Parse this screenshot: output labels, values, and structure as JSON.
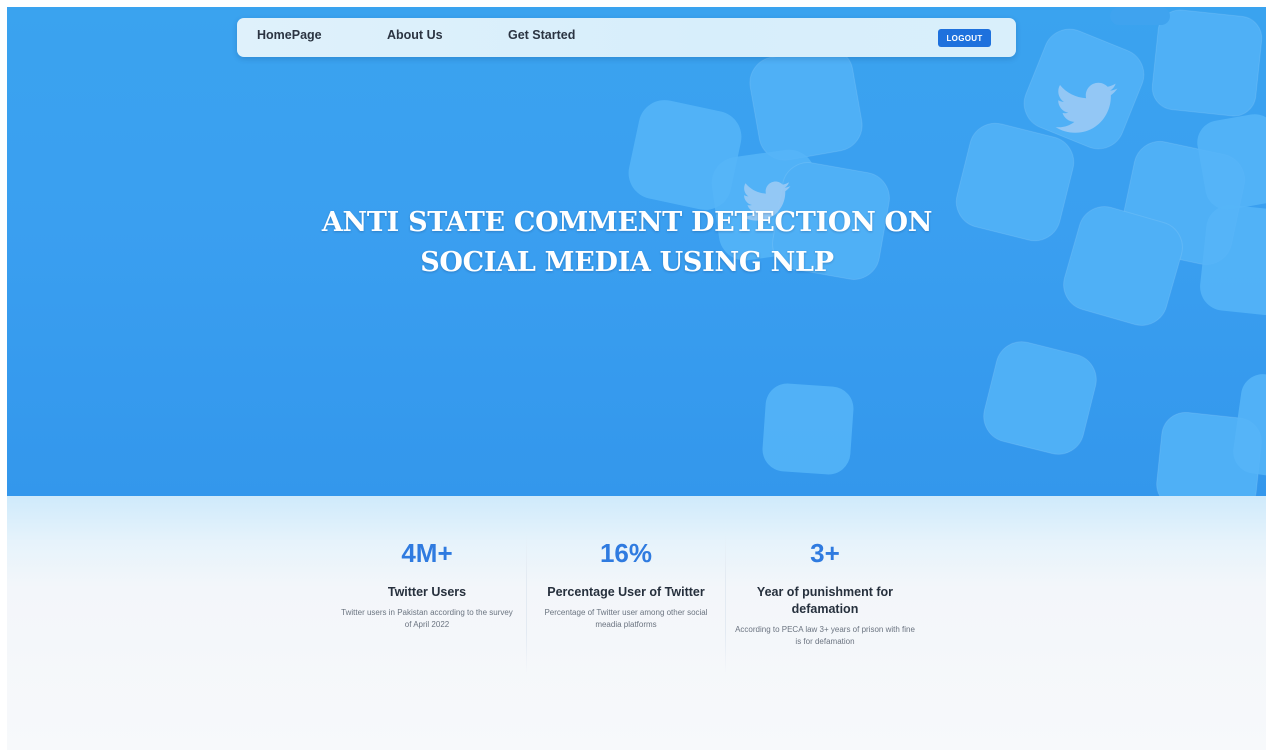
{
  "nav": {
    "home": "HomePage",
    "about": "About Us",
    "get_started": "Get Started",
    "logout": "LOGOUT"
  },
  "hero": {
    "title": "ANTI STATE COMMENT DETECTION ON SOCIAL MEDIA USING NLP"
  },
  "stats": [
    {
      "number": "4M+",
      "title": "Twitter Users",
      "description": "Twitter users in Pakistan according to the survey of April 2022"
    },
    {
      "number": "16%",
      "title": "Percentage User of Twitter",
      "description": "Percentage of Twitter user among other social meadia platforms"
    },
    {
      "number": "3+",
      "title": "Year of punishment for defamation",
      "description": "According to PECA law 3+ years of prison with fine is for defamation"
    }
  ],
  "colors": {
    "hero_blue": "#3a9ff0",
    "accent_blue": "#2f7be0",
    "logout_button": "#1e71dd",
    "navbar_bg": "#dcf0fb"
  },
  "icons": {
    "hero_decoration": "twitter-bird-icon"
  }
}
